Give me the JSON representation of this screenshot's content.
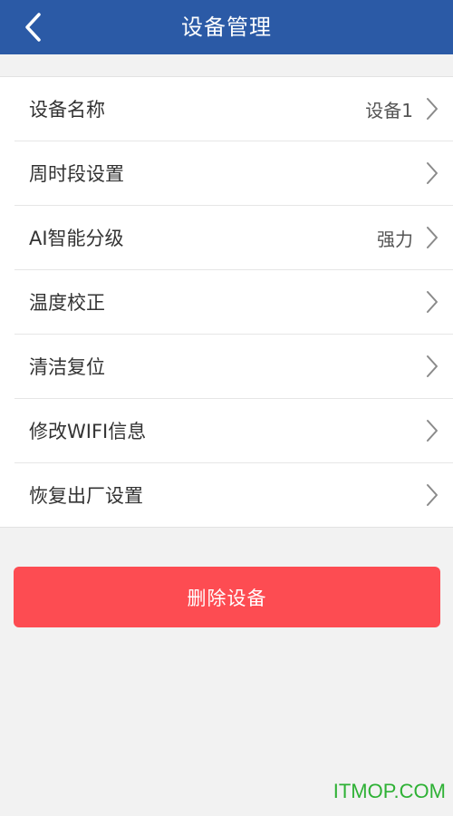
{
  "header": {
    "title": "设备管理"
  },
  "list": {
    "items": [
      {
        "label": "设备名称",
        "value": "设备1"
      },
      {
        "label": "周时段设置",
        "value": ""
      },
      {
        "label": "AI智能分级",
        "value": "强力"
      },
      {
        "label": "温度校正",
        "value": ""
      },
      {
        "label": "清洁复位",
        "value": ""
      },
      {
        "label": "修改WIFI信息",
        "value": ""
      },
      {
        "label": "恢复出厂设置",
        "value": ""
      }
    ]
  },
  "actions": {
    "delete_label": "删除设备"
  },
  "watermark": {
    "text": "ITMOP.COM"
  },
  "colors": {
    "header_bg": "#2b5aa6",
    "delete_bg": "#fd4c52",
    "watermark": "#2eb135",
    "page_bg": "#f2f2f2"
  },
  "icons": {
    "back": "chevron-left-icon",
    "row_arrow": "chevron-right-icon"
  }
}
